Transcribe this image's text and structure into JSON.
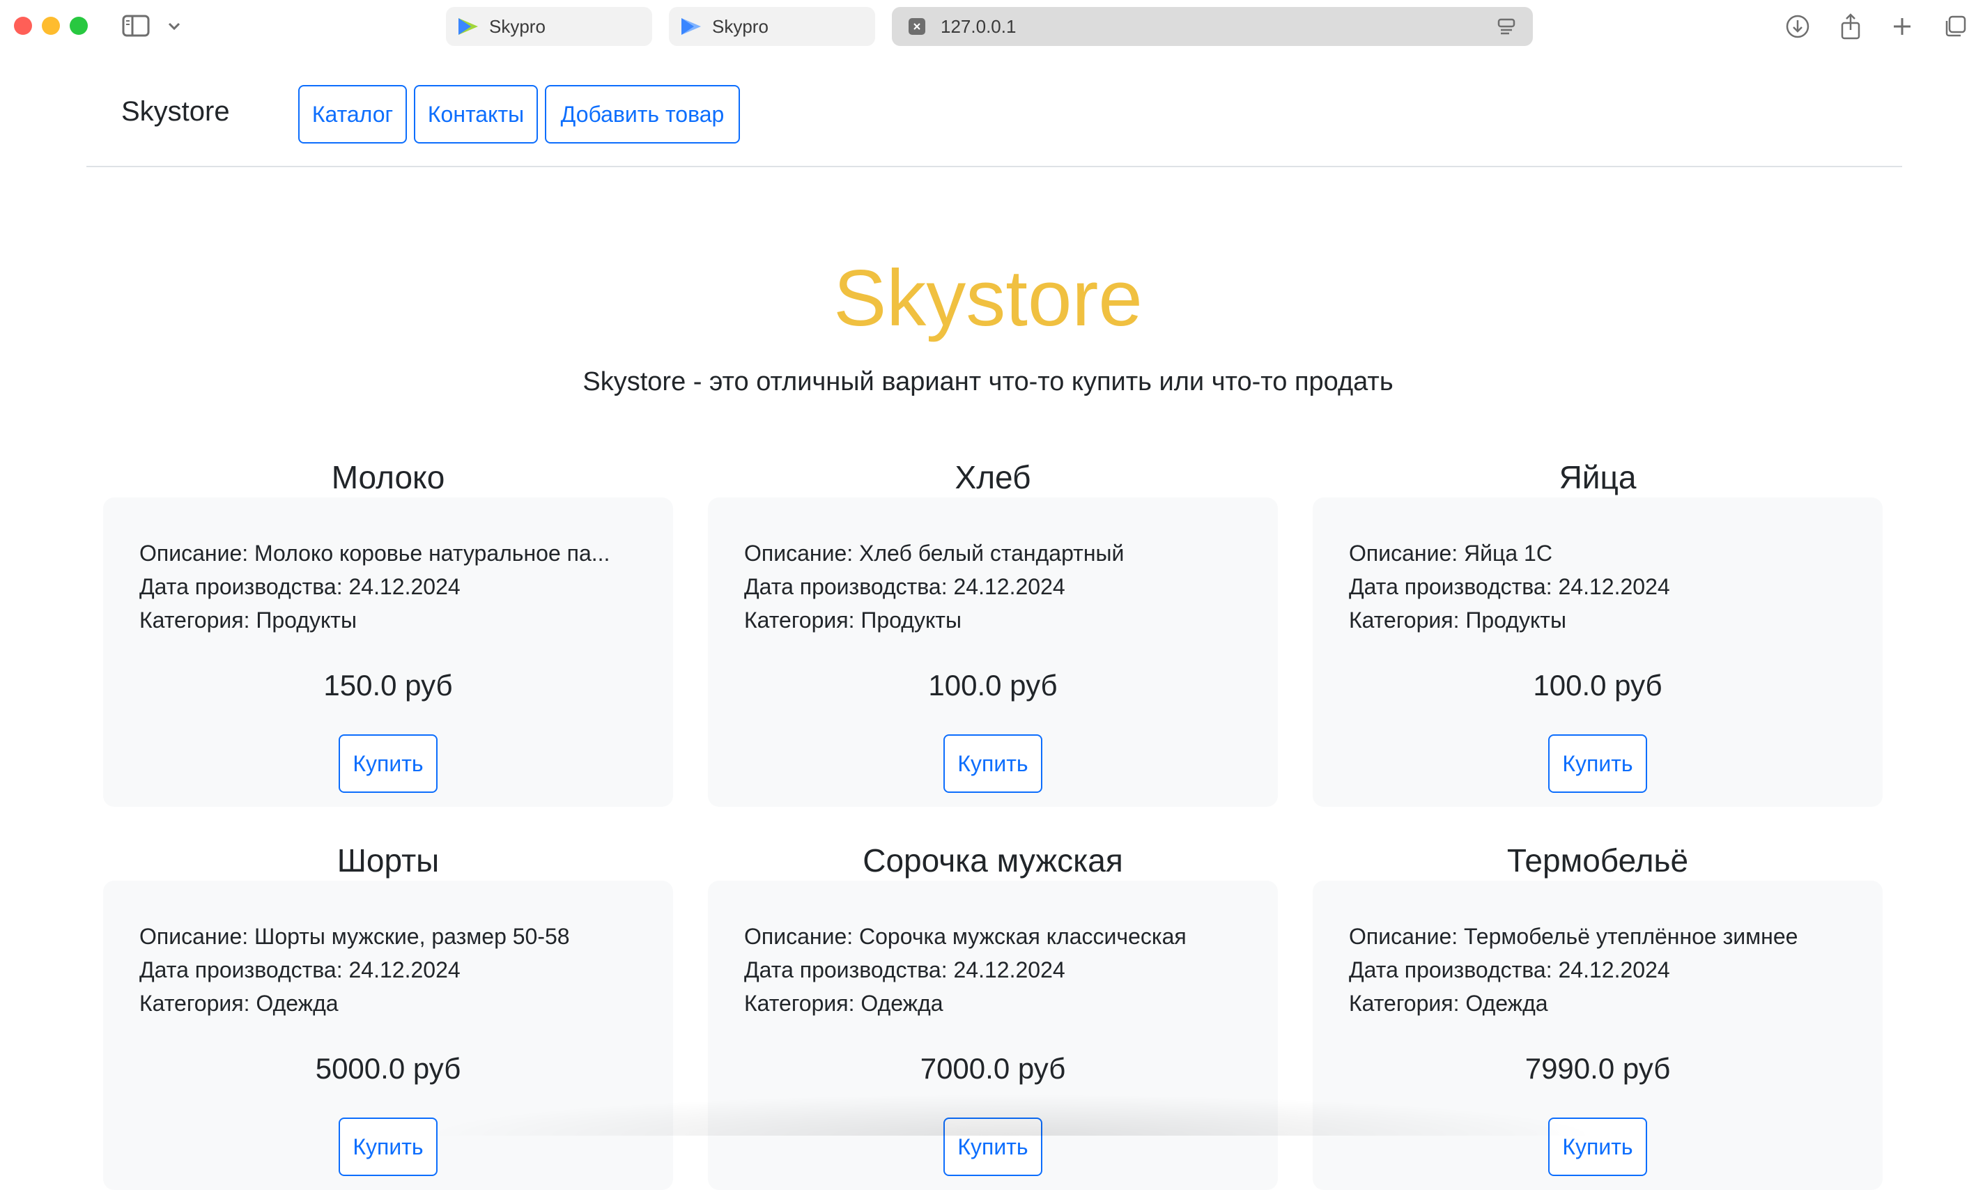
{
  "browser": {
    "tabs": [
      {
        "label": "Skypro"
      },
      {
        "label": "Skypro"
      },
      {
        "label": "127.0.0.1"
      }
    ],
    "icons": [
      "sidebar-icon",
      "chevron-down-icon",
      "download-icon",
      "share-icon",
      "plus-icon",
      "tabs-overview-icon",
      "reader-icon"
    ]
  },
  "header": {
    "brand": "Skystore",
    "nav": {
      "catalog": "Каталог",
      "contacts": "Контакты",
      "add_product": "Добавить товар"
    }
  },
  "hero": {
    "title": "Skystore",
    "subtitle": "Skystore - это отличный вариант что-то купить или что-то продать"
  },
  "products": [
    {
      "name": "Молоко",
      "description": "Описание: Молоко коровье натуральное па...",
      "date": "Дата производства: 24.12.2024",
      "category": "Категория: Продукты",
      "price": "150.0 руб",
      "buy": "Купить"
    },
    {
      "name": "Хлеб",
      "description": "Описание: Хлеб белый стандартный",
      "date": "Дата производства: 24.12.2024",
      "category": "Категория: Продукты",
      "price": "100.0 руб",
      "buy": "Купить"
    },
    {
      "name": "Яйца",
      "description": "Описание: Яйца 1С",
      "date": "Дата производства: 24.12.2024",
      "category": "Категория: Продукты",
      "price": "100.0 руб",
      "buy": "Купить"
    },
    {
      "name": "Шорты",
      "description": "Описание: Шорты мужские, размер 50-58",
      "date": "Дата производства: 24.12.2024",
      "category": "Категория: Одежда",
      "price": "5000.0 руб",
      "buy": "Купить"
    },
    {
      "name": "Сорочка мужская",
      "description": "Описание: Сорочка мужская классическая",
      "date": "Дата производства: 24.12.2024",
      "category": "Категория: Одежда",
      "price": "7000.0 руб",
      "buy": "Купить"
    },
    {
      "name": "Термобельё",
      "description": "Описание: Термобельё утеплённое зимнее",
      "date": "Дата производства: 24.12.2024",
      "category": "Категория: Одежда",
      "price": "7990.0 руб",
      "buy": "Купить"
    }
  ],
  "colors": {
    "accent": "#0d6efd",
    "hero_title": "#f0c040",
    "card_bg": "#f8f9fa"
  }
}
